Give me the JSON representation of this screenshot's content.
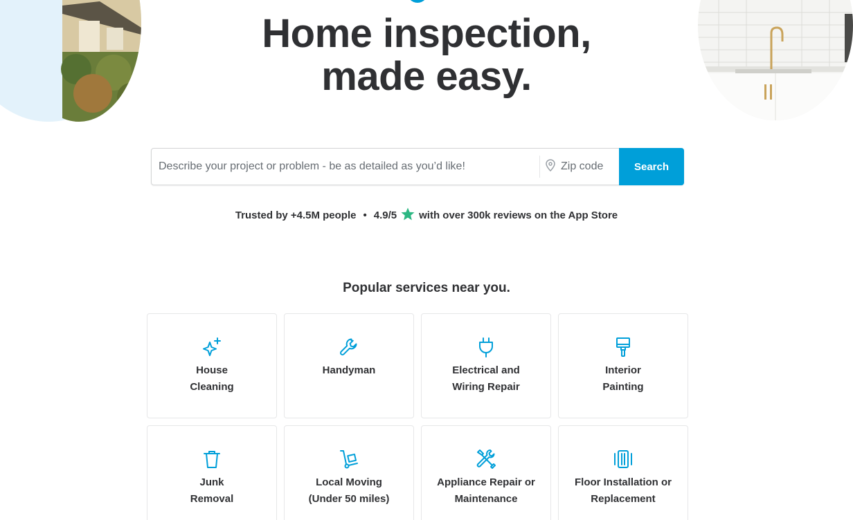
{
  "headline": {
    "line1": "Home inspection,",
    "line2": "made easy."
  },
  "search": {
    "query_placeholder": "Describe your project or problem - be as detailed as you’d like!",
    "zip_placeholder": "Zip code",
    "button_label": "Search"
  },
  "trust": {
    "people": "Trusted by +4.5M people",
    "separator": "•",
    "rating": "4.9/5",
    "reviews": "with over 300k reviews on the App Store",
    "star_color": "#2db783"
  },
  "popular": {
    "title": "Popular services near you.",
    "services": [
      {
        "label": "House\nCleaning",
        "icon": "sparkle-icon"
      },
      {
        "label": "Handyman",
        "icon": "wrench-icon"
      },
      {
        "label": "Electrical and\nWiring Repair",
        "icon": "plug-icon"
      },
      {
        "label": "Interior\nPainting",
        "icon": "paintbrush-icon"
      },
      {
        "label": "Junk\nRemoval",
        "icon": "trash-can-icon"
      },
      {
        "label": "Local Moving\n(Under 50 miles)",
        "icon": "hand-truck-icon"
      },
      {
        "label": "Appliance Repair or\nMaintenance",
        "icon": "tools-icon"
      },
      {
        "label": "Floor Installation or\nReplacement",
        "icon": "floor-panels-icon"
      }
    ]
  },
  "colors": {
    "accent": "#009fd9",
    "text": "#2f3033",
    "border": "#e6e7e8"
  }
}
